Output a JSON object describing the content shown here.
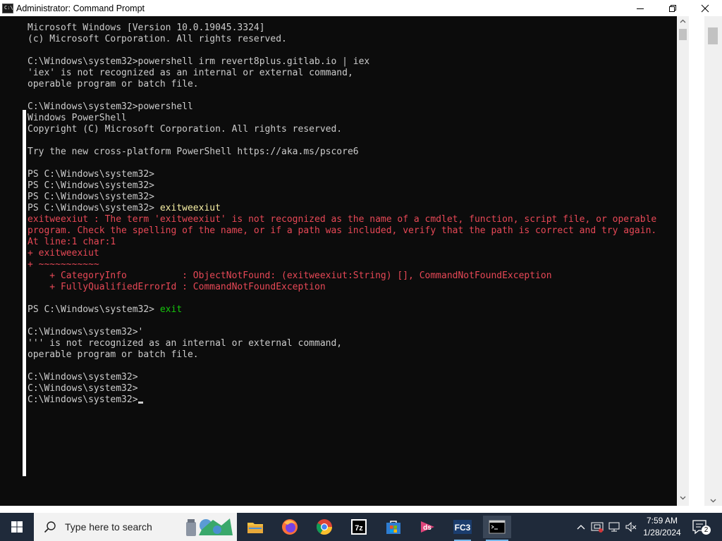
{
  "window": {
    "title": "Administrator: Command Prompt",
    "icon_text": "C:\\",
    "icons": {
      "minimize": "minimize-icon",
      "maximize": "maximize-icon",
      "close": "close-icon",
      "app": "cmd-icon"
    }
  },
  "console": {
    "lines": [
      {
        "text": "Microsoft Windows [Version 10.0.19045.3324]",
        "color": "default"
      },
      {
        "text": "(c) Microsoft Corporation. All rights reserved.",
        "color": "default"
      },
      {
        "text": "",
        "color": "default"
      },
      {
        "text": "C:\\Windows\\system32>powershell irm revert8plus.gitlab.io | iex",
        "color": "default"
      },
      {
        "text": "'iex' is not recognized as an internal or external command,",
        "color": "default"
      },
      {
        "text": "operable program or batch file.",
        "color": "default"
      },
      {
        "text": "",
        "color": "default"
      },
      {
        "text": "C:\\Windows\\system32>powershell",
        "color": "default"
      },
      {
        "text": "Windows PowerShell",
        "color": "default"
      },
      {
        "text": "Copyright (C) Microsoft Corporation. All rights reserved.",
        "color": "default"
      },
      {
        "text": "",
        "color": "default"
      },
      {
        "text": "Try the new cross-platform PowerShell https://aka.ms/pscore6",
        "color": "default"
      },
      {
        "text": "",
        "color": "default"
      },
      {
        "text": "PS C:\\Windows\\system32>",
        "color": "default"
      },
      {
        "text": "PS C:\\Windows\\system32>",
        "color": "default"
      },
      {
        "text": "PS C:\\Windows\\system32>",
        "color": "default"
      },
      {
        "prompt": "PS C:\\Windows\\system32> ",
        "command": "exitweexiut",
        "command_color": "yellow"
      },
      {
        "text": "exitweexiut : The term 'exitweexiut' is not recognized as the name of a cmdlet, function, script file, or operable",
        "color": "red"
      },
      {
        "text": "program. Check the spelling of the name, or if a path was included, verify that the path is correct and try again.",
        "color": "red"
      },
      {
        "text": "At line:1 char:1",
        "color": "red"
      },
      {
        "text": "+ exitweexiut",
        "color": "red"
      },
      {
        "text": "+ ~~~~~~~~~~~",
        "color": "red"
      },
      {
        "text": "    + CategoryInfo          : ObjectNotFound: (exitweexiut:String) [], CommandNotFoundException",
        "color": "red"
      },
      {
        "text": "    + FullyQualifiedErrorId : CommandNotFoundException",
        "color": "red"
      },
      {
        "text": "",
        "color": "default"
      },
      {
        "prompt": "PS C:\\Windows\\system32> ",
        "command": "exit",
        "command_color": "green"
      },
      {
        "text": "",
        "color": "default"
      },
      {
        "text": "C:\\Windows\\system32>'",
        "color": "default"
      },
      {
        "text": "''' is not recognized as an internal or external command,",
        "color": "default"
      },
      {
        "text": "operable program or batch file.",
        "color": "default"
      },
      {
        "text": "",
        "color": "default"
      },
      {
        "text": "C:\\Windows\\system32>",
        "color": "default"
      },
      {
        "text": "C:\\Windows\\system32>",
        "color": "default"
      },
      {
        "text": "C:\\Windows\\system32>",
        "color": "default",
        "cursor": true
      }
    ],
    "colors": {
      "default": "#cccccc",
      "red": "#e74856",
      "yellow": "#f9f1a5",
      "green": "#16c60c",
      "background": "#0c0c0c"
    }
  },
  "taskbar": {
    "search_placeholder": "Type here to search",
    "apps": [
      {
        "name": "file-explorer-icon"
      },
      {
        "name": "firefox-icon"
      },
      {
        "name": "chrome-icon"
      },
      {
        "name": "7zip-icon",
        "label": "7z"
      },
      {
        "name": "microsoft-store-icon"
      },
      {
        "name": "ds-app-icon",
        "label": "ds"
      },
      {
        "name": "fc3-app-icon",
        "label": "FC3"
      },
      {
        "name": "command-prompt-icon"
      }
    ],
    "clock_time": "7:59 AM",
    "clock_date": "1/28/2024",
    "notification_count": "2"
  }
}
